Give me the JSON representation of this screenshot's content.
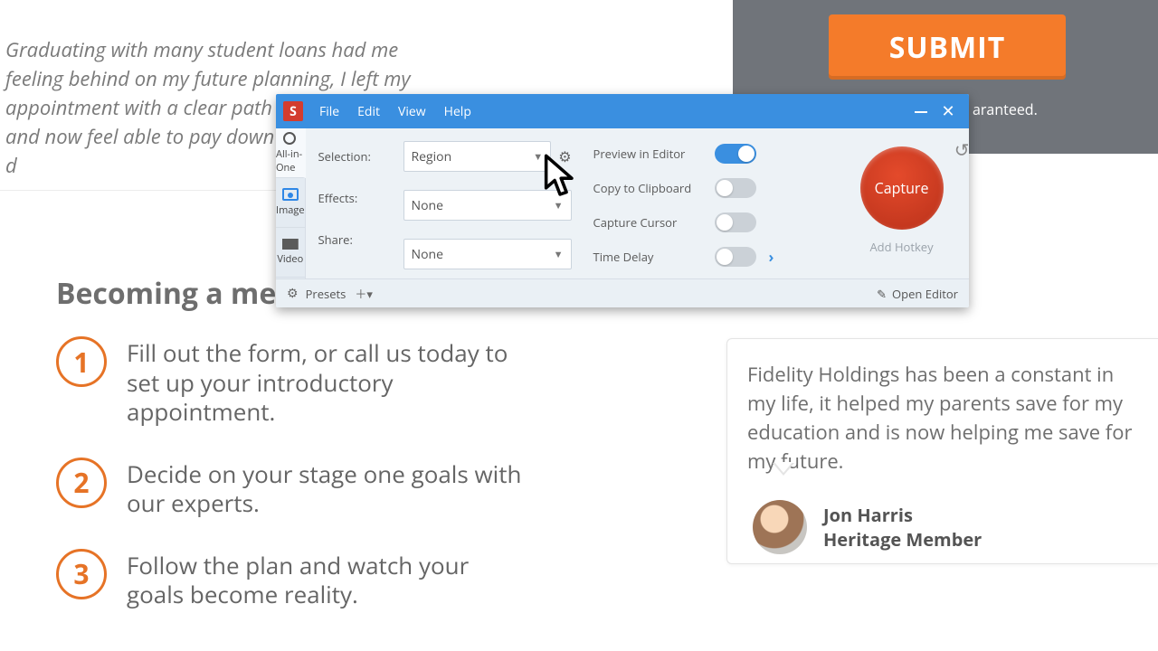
{
  "bg": {
    "submit_label": "SUBMIT",
    "guarantee_text": "aranteed.",
    "testimonial_top": "Graduating with many student loans had me feeling behind on my future planning, I left my appointment with a clear path to my retirement and now feel able to pay down my educational d",
    "becoming_heading": "Becoming a mem",
    "steps": [
      {
        "num": "1",
        "text": "Fill out the form, or call us today to set up your introductory appointment."
      },
      {
        "num": "2",
        "text": "Decide on your stage one goals with our experts."
      },
      {
        "num": "3",
        "text": "Follow the plan and watch your goals become reality."
      }
    ],
    "card_body": "Fidelity Holdings has been a constant in my life, it helped my parents save for my education and is now helping me save for my future.",
    "author_name": "Jon Harris",
    "author_role": "Heritage Member"
  },
  "snagit": {
    "logo": "S",
    "menu": {
      "file": "File",
      "edit": "Edit",
      "view": "View",
      "help": "Help"
    },
    "modes": {
      "all": "All-in-One",
      "image": "Image",
      "video": "Video"
    },
    "labels": {
      "selection": "Selection:",
      "effects": "Effects:",
      "share": "Share:"
    },
    "values": {
      "selection": "Region",
      "effects": "None",
      "share": "None"
    },
    "toggles": {
      "preview": "Preview in Editor",
      "clipboard": "Copy to Clipboard",
      "cursor": "Capture Cursor",
      "delay": "Time Delay"
    },
    "capture_label": "Capture",
    "hotkey_label": "Add Hotkey",
    "footer": {
      "presets": "Presets",
      "open_editor": "Open Editor"
    }
  }
}
